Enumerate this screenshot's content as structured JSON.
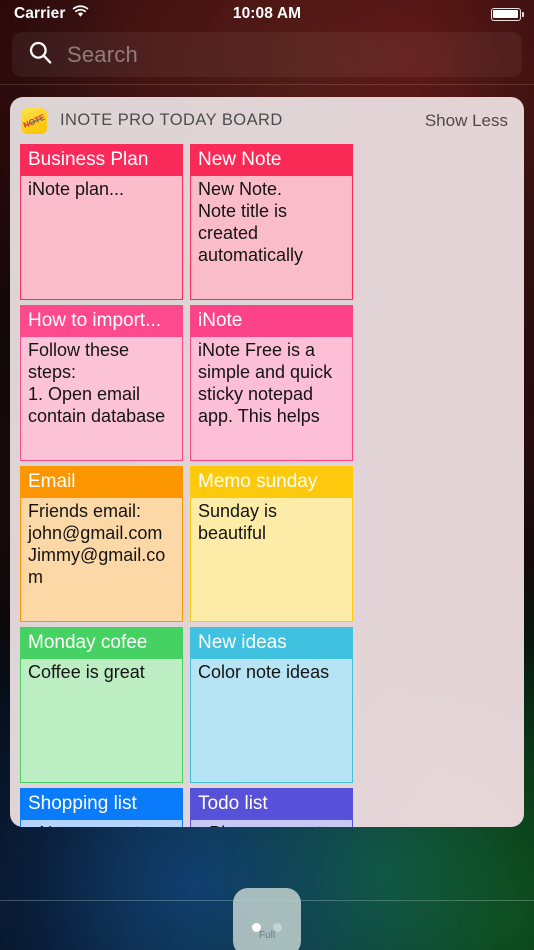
{
  "status_bar": {
    "carrier": "Carrier",
    "wifi_icon": "wifi-icon",
    "time": "10:08 AM",
    "battery_icon": "battery-full-icon",
    "battery_level_percent": 100
  },
  "search": {
    "icon": "search-icon",
    "placeholder": "Search",
    "value": ""
  },
  "widget": {
    "app_icon": {
      "name": "inote-app-icon",
      "text": "NOTE",
      "background_color": "#ffd21f",
      "text_color": "#e8342c"
    },
    "title": "INOTE PRO TODAY BOARD",
    "show_less_label": "Show Less",
    "background_color": "#e3dadc"
  },
  "notes": [
    {
      "title": "Business Plan",
      "body": "iNote plan...",
      "header_color": "#fa2a5a",
      "body_color": "#fbbccb",
      "border_color": "#fa2a5a"
    },
    {
      "title": "New Note",
      "body": "New Note.\nNote title is created automatically",
      "header_color": "#fa2a56",
      "body_color": "#fbbcc9",
      "border_color": "#fa2a56"
    },
    {
      "title": "How to import...",
      "body": "Follow these steps:\n1. Open email contain database",
      "header_color": "#fd4a8c",
      "body_color": "#fcc3d6",
      "border_color": "#fd4a8c"
    },
    {
      "title": "iNote",
      "body": "iNote Free is a simple and quick sticky notepad app. This  helps",
      "header_color": "#fc4288",
      "body_color": "#fcbfd5",
      "border_color": "#fc4288"
    },
    {
      "title": "Email",
      "body": "Friends email:\njohn@gmail.com\nJimmy@gmail.com",
      "header_color": "#fb9500",
      "body_color": "#fcd8a7",
      "border_color": "#fb9500"
    },
    {
      "title": "Memo sunday",
      "body": "Sunday is beautiful",
      "header_color": "#fdc90d",
      "body_color": "#fdeca8",
      "border_color": "#fdc90d"
    },
    {
      "title": "Monday cofee",
      "body": "Coffee is great",
      "header_color": "#45d263",
      "body_color": "#bdedc3",
      "border_color": "#45d263"
    },
    {
      "title": "New ideas",
      "body": "Color note ideas",
      "header_color": "#3fc1df",
      "body_color": "#b6e4f4",
      "border_color": "#3fc1df"
    },
    {
      "title": "Shopping list",
      "body": "• New computer\n• New mouse",
      "header_color": "#0a7cfb",
      "body_color": "#b3d4fd",
      "border_color": "#0a7cfb"
    },
    {
      "title": "Todo list",
      "body": "• Blog new post\n• Hangout with friends",
      "header_color": "#5750d8",
      "body_color": "#c8c8f5",
      "border_color": "#5750d8"
    }
  ],
  "page_indicator": {
    "total": 2,
    "current": 1
  }
}
